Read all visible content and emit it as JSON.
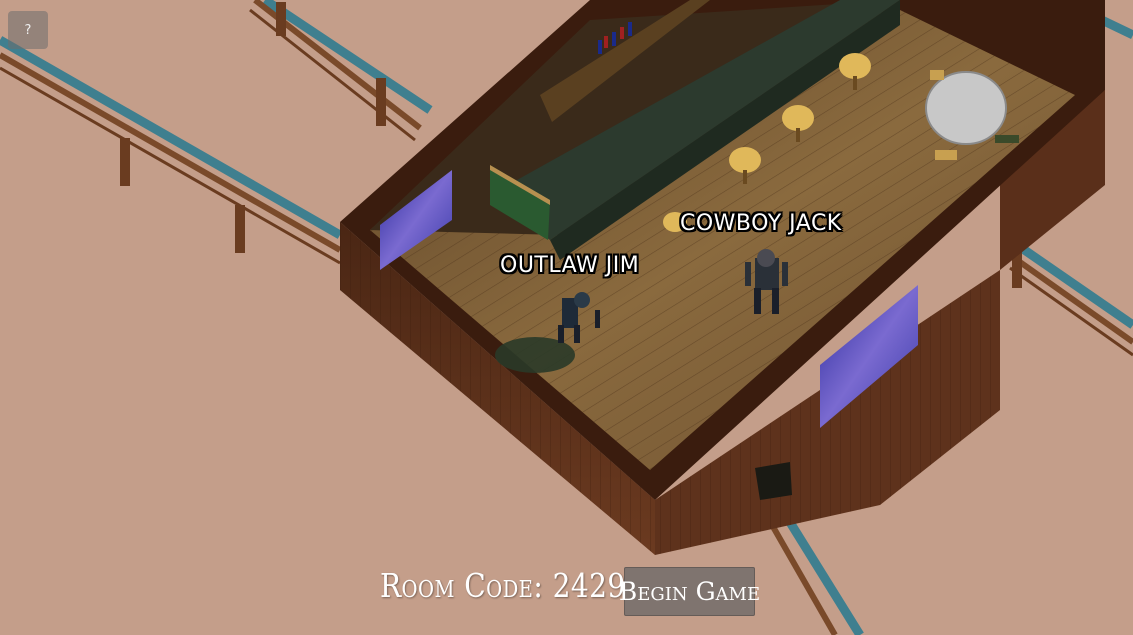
{
  "help": {
    "label": "?"
  },
  "players": [
    {
      "name": "OUTLAW JIM"
    },
    {
      "name": "COWBOY JACK"
    }
  ],
  "room": {
    "label": "Room Code:",
    "code": "2429"
  },
  "actions": {
    "begin_label": "Begin Game"
  },
  "colors": {
    "ground": "#c49e8a",
    "fence_wood": "#7a4a2a",
    "fence_water": "#3f7f8f",
    "wall_wood": "#5a2f1a",
    "floor_wood": "#7a5a34",
    "bar_counter": "#2c3a2e",
    "button_bg": "#7f746f"
  }
}
